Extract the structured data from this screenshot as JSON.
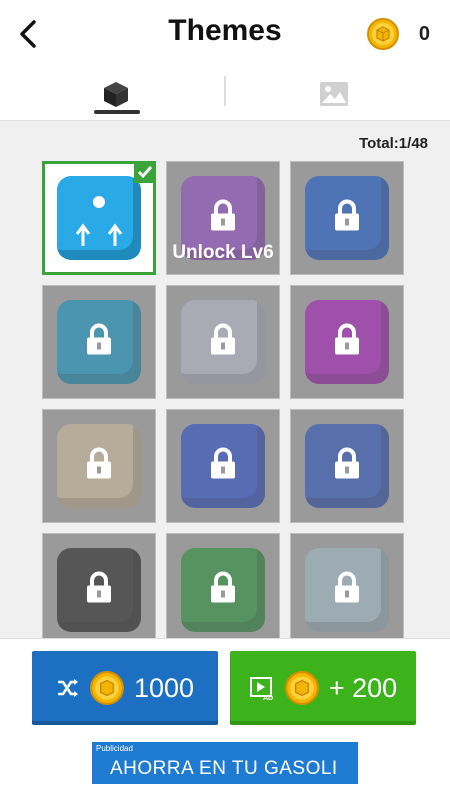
{
  "header": {
    "title": "Themes",
    "coin_count": "0"
  },
  "tabs": [
    {
      "name": "cubes",
      "icon": "cube-icon",
      "active": true
    },
    {
      "name": "backgrounds",
      "icon": "image-icon",
      "active": false
    }
  ],
  "grid": {
    "total_label": "Total:1/48",
    "tiles": [
      {
        "theme": "blue-dot",
        "color": "#29a9e6",
        "locked": false,
        "selected": true
      },
      {
        "theme": "emoji-purple",
        "color": "#8f4cc0",
        "locked": true,
        "label": "Unlock Lv6"
      },
      {
        "theme": "sun-blue",
        "color": "#1e5bc8",
        "locked": true
      },
      {
        "theme": "heart-teal",
        "color": "#1793c0",
        "locked": true
      },
      {
        "theme": "holo-silver",
        "color": "#b5b5c8",
        "locked": true
      },
      {
        "theme": "neon-magenta",
        "color": "#a31fb5",
        "locked": true
      },
      {
        "theme": "face-beige",
        "color": "#c8b89a",
        "locked": true
      },
      {
        "theme": "smile-blue",
        "color": "#2b4fc5",
        "locked": true
      },
      {
        "theme": "eyes-yellow",
        "color": "#2c55b8",
        "locked": true
      },
      {
        "theme": "neon-dark",
        "color": "#2a2a2a",
        "locked": true
      },
      {
        "theme": "parachute-green",
        "color": "#2b8e3c",
        "locked": true
      },
      {
        "theme": "rainbow-holo",
        "color": "#9fb7c4",
        "locked": true
      }
    ]
  },
  "buttons": {
    "shuffle": {
      "amount": "1000",
      "icon": "shuffle-icon",
      "color": "#1d6fc2"
    },
    "watch_ad": {
      "amount": "+ 200",
      "icon": "video-ad-icon",
      "badge": "AD",
      "color": "#3cb21b"
    }
  },
  "ad_banner": {
    "small_label": "Publicidad",
    "text": "AHORRA EN TU GASOLI"
  },
  "colors": {
    "accent_green": "#3aa339",
    "coin_gold": "#f2b705"
  }
}
